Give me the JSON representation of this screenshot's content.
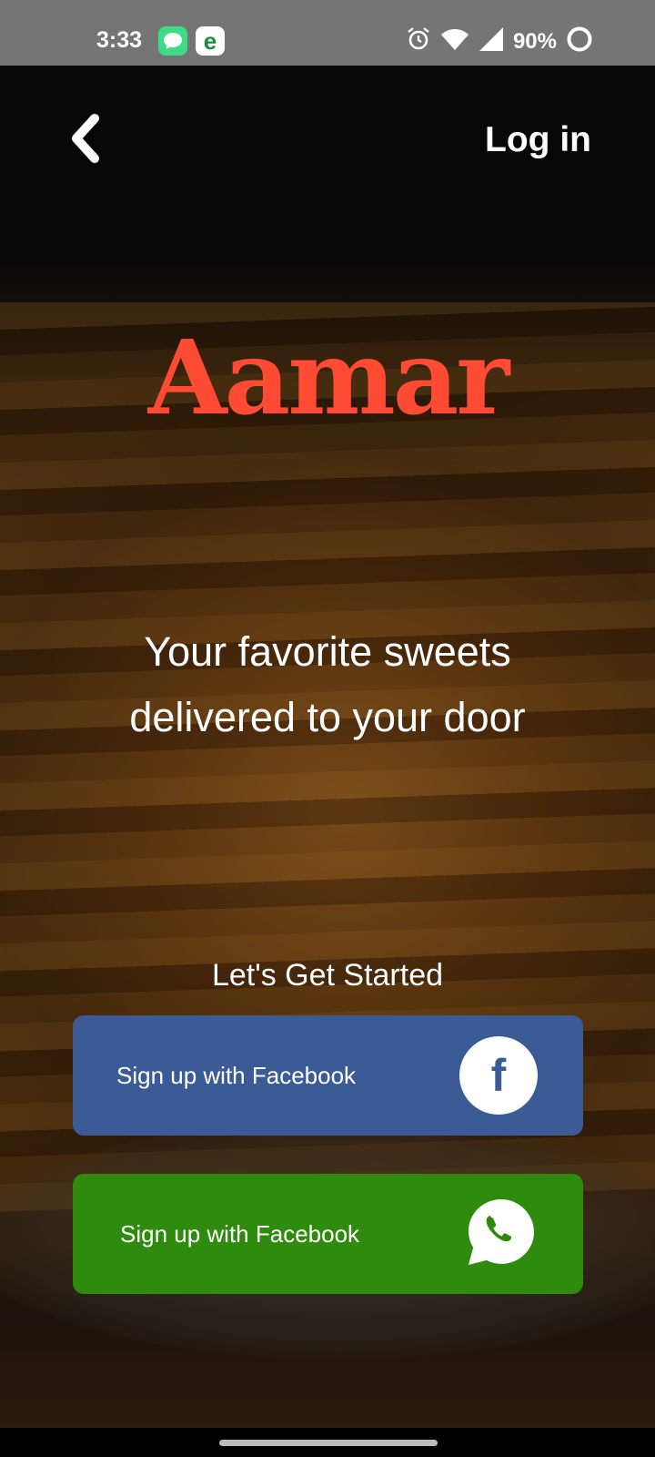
{
  "status_bar": {
    "time": "3:33",
    "battery_percent": "90%",
    "icons": [
      "messages-app-icon",
      "e-app-icon",
      "alarm-icon",
      "wifi-icon",
      "signal-icon",
      "battery-ring-icon"
    ]
  },
  "nav": {
    "back_icon": "chevron-left-icon",
    "login_label": "Log in"
  },
  "brand": {
    "logo_text": "Aamar",
    "logo_color": "#ff4b33"
  },
  "hero": {
    "tagline_line1": "Your favorite sweets",
    "tagline_line2": "delivered to your door"
  },
  "cta": {
    "heading": "Let's Get Started",
    "buttons": [
      {
        "label": "Sign up with Facebook",
        "icon": "facebook-icon",
        "color": "#3b5b96"
      },
      {
        "label": "Sign up with Facebook",
        "icon": "whatsapp-icon",
        "color": "#2e8b0e"
      }
    ]
  }
}
